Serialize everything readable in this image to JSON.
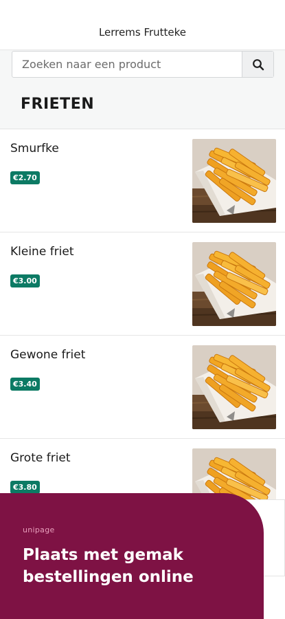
{
  "header": {
    "title": "Lerrems Frutteke"
  },
  "search": {
    "placeholder": "Zoeken naar een product"
  },
  "category": {
    "title": "FRIETEN"
  },
  "products": [
    {
      "name": "Smurfke",
      "price": "€2.70"
    },
    {
      "name": "Kleine friet",
      "price": "€3.00"
    },
    {
      "name": "Gewone friet",
      "price": "€3.40"
    },
    {
      "name": "Grote friet",
      "price": "€3.80"
    }
  ],
  "promo": {
    "brand": "unipage",
    "headline": "Plaats met gemak bestellingen online"
  },
  "colors": {
    "price_badge": "#0c7a64",
    "promo_background": "#7e1244",
    "edit_icon": "#2d6fd6"
  },
  "icons": {
    "search": "search-icon",
    "edit": "pencil-icon"
  }
}
